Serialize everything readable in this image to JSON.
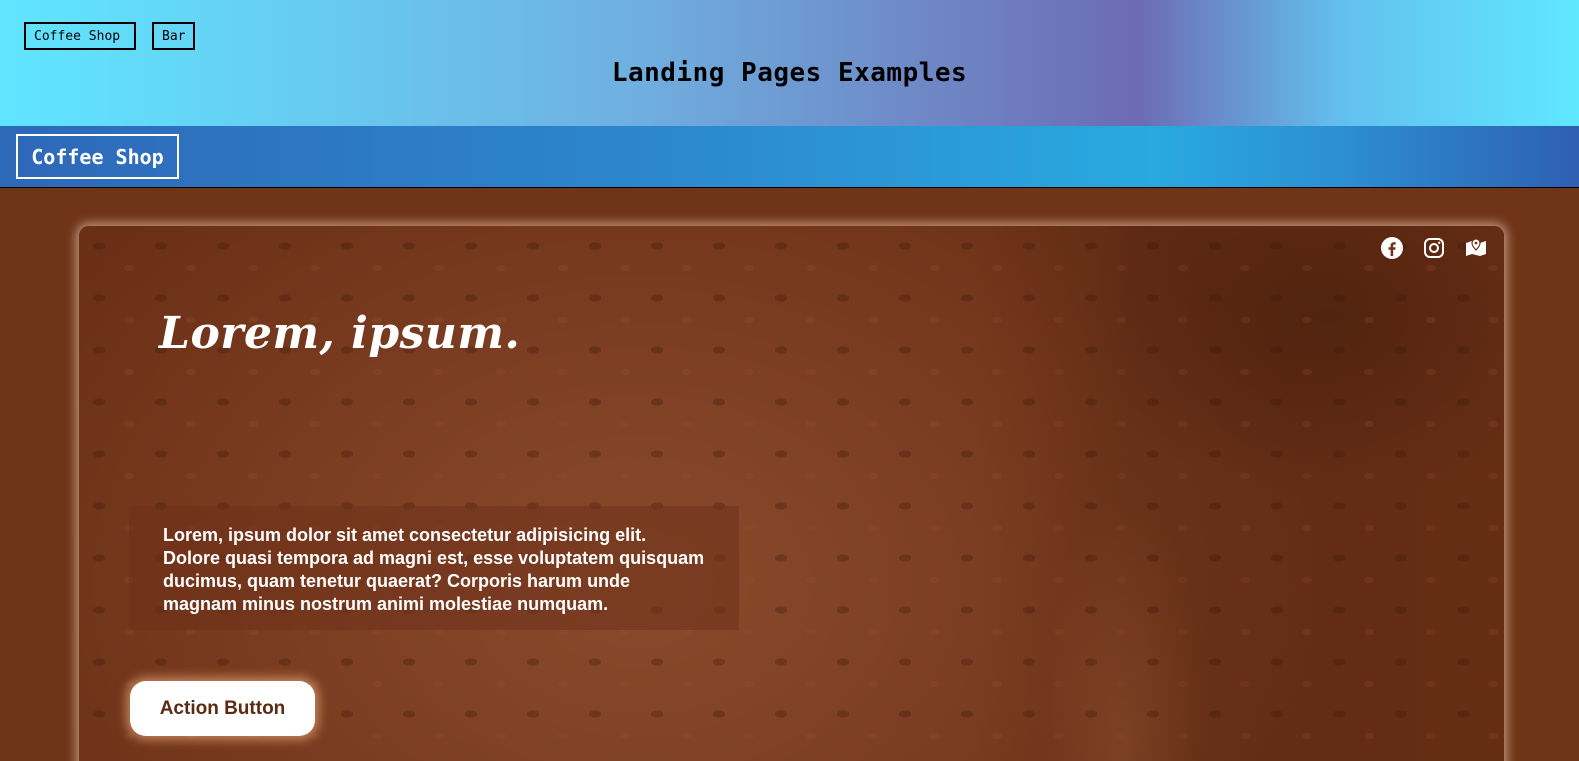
{
  "top_header": {
    "tabs": [
      "Coffee Shop",
      "Bar"
    ],
    "title": "Landing Pages Examples"
  },
  "navbar": {
    "brand": "Coffee Shop"
  },
  "hero": {
    "title": "Lorem, ipsum.",
    "text": "Lorem, ipsum dolor sit amet consectetur adipisicing elit. Dolore quasi tempora ad magni est, esse voluptatem quisquam ducimus, quam tenetur quaerat? Corporis harum unde magnam minus nostrum animi molestiae numquam.",
    "button_label": "Action Button",
    "social_icons": [
      "facebook-icon",
      "instagram-icon",
      "map-icon"
    ]
  },
  "colors": {
    "header_gradient": [
      "#5fe6ff",
      "#6d6bb3"
    ],
    "navbar_gradient": [
      "#2e68b8",
      "#29a9e0"
    ],
    "background": "#6f3519",
    "button_text": "#5a2a12"
  }
}
